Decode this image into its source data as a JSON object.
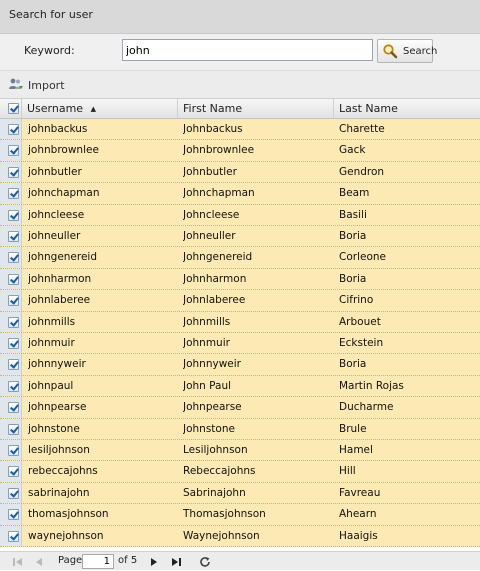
{
  "panel": {
    "title": "Search for user"
  },
  "search": {
    "keyword_label": "Keyword:",
    "keyword_value": "john",
    "button_label": "Search"
  },
  "toolbar": {
    "import_label": "Import"
  },
  "grid": {
    "columns": [
      "Username",
      "First Name",
      "Last Name"
    ],
    "sort_column": "Username",
    "sort_direction": "ascending",
    "rows": [
      {
        "username": "johnbackus",
        "first": "Johnbackus",
        "last": "Charette"
      },
      {
        "username": "johnbrownlee",
        "first": "Johnbrownlee",
        "last": "Gack"
      },
      {
        "username": "johnbutler",
        "first": "Johnbutler",
        "last": "Gendron"
      },
      {
        "username": "johnchapman",
        "first": "Johnchapman",
        "last": "Beam"
      },
      {
        "username": "johncleese",
        "first": "Johncleese",
        "last": "Basili"
      },
      {
        "username": "johneuller",
        "first": "Johneuller",
        "last": "Boria"
      },
      {
        "username": "johngenereid",
        "first": "Johngenereid",
        "last": "Corleone"
      },
      {
        "username": "johnharmon",
        "first": "Johnharmon",
        "last": "Boria"
      },
      {
        "username": "johnlaberee",
        "first": "Johnlaberee",
        "last": "Cifrino"
      },
      {
        "username": "johnmills",
        "first": "Johnmills",
        "last": "Arbouet"
      },
      {
        "username": "johnmuir",
        "first": "Johnmuir",
        "last": "Eckstein"
      },
      {
        "username": "johnnyweir",
        "first": "Johnnyweir",
        "last": "Boria"
      },
      {
        "username": "johnpaul",
        "first": "John Paul",
        "last": "Martin Rojas"
      },
      {
        "username": "johnpearse",
        "first": "Johnpearse",
        "last": "Ducharme"
      },
      {
        "username": "johnstone",
        "first": "Johnstone",
        "last": "Brule"
      },
      {
        "username": "lesiljohnson",
        "first": "Lesiljohnson",
        "last": "Hamel"
      },
      {
        "username": "rebeccajohns",
        "first": "Rebeccajohns",
        "last": "Hill"
      },
      {
        "username": "sabrinajohn",
        "first": "Sabrinajohn",
        "last": "Favreau"
      },
      {
        "username": "thomasjohnson",
        "first": "Thomasjohnson",
        "last": "Ahearn"
      },
      {
        "username": "waynejohnson",
        "first": "Waynejohnson",
        "last": "Haaigis"
      }
    ]
  },
  "pager": {
    "page_label": "Page",
    "current_page": "1",
    "of_label": "of 5"
  },
  "colors": {
    "row_bg": "#fde9b3",
    "header_bg": "#d9d9d9",
    "accent": "#1b5d98"
  }
}
